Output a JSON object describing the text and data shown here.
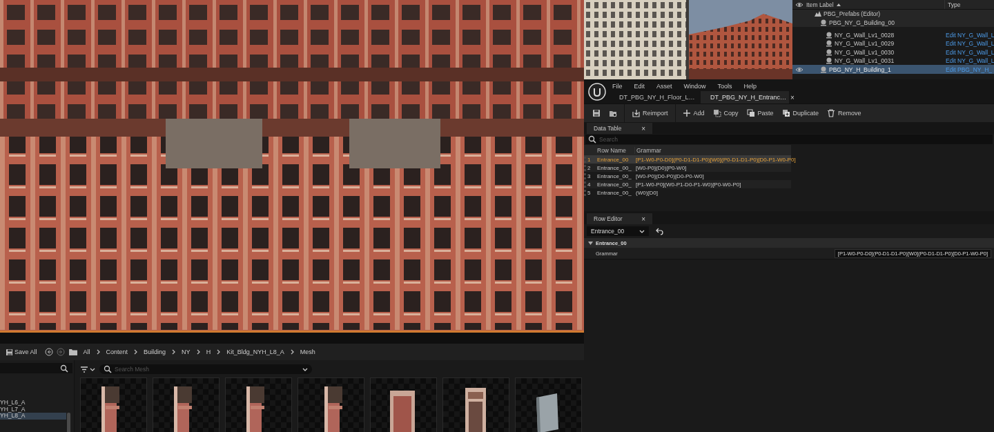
{
  "outliner": {
    "columns": [
      "Item Label",
      "Type"
    ],
    "rows": [
      {
        "label": "PBG_Prefabs (Editor)",
        "kind": "level",
        "selected": false,
        "visible": false,
        "children": [
          {
            "label": "PBG_NY_G_Building_00",
            "kind": "actor",
            "selected": false,
            "visible": false,
            "children": [
              {
                "label": "NY_G_Wall_Lv1_0028",
                "type": "Edit NY_G_Wall_L",
                "kind": "actor",
                "selected": false,
                "visible": false
              },
              {
                "label": "NY_G_Wall_Lv1_0029",
                "type": "Edit NY_G_Wall_L",
                "kind": "actor",
                "selected": false,
                "visible": false
              },
              {
                "label": "NY_G_Wall_Lv1_0030",
                "type": "Edit NY_G_Wall_L",
                "kind": "actor",
                "selected": false,
                "visible": false
              },
              {
                "label": "NY_G_Wall_Lv1_0031",
                "type": "Edit NY_G_Wall_L",
                "kind": "actor",
                "selected": false,
                "visible": false
              }
            ]
          },
          {
            "label": "PBG_NY_H_Building_1",
            "type": "Edit PBG_NY_H_",
            "kind": "actor",
            "selected": true,
            "visible": true
          }
        ]
      }
    ]
  },
  "editor": {
    "menu": [
      "File",
      "Edit",
      "Asset",
      "Window",
      "Tools",
      "Help"
    ],
    "tabs": [
      {
        "label": "DT_PBG_NY_H_Floor_L…",
        "selected": false
      },
      {
        "label": "DT_PBG_NY_H_Entranc…",
        "selected": true,
        "close": "×"
      }
    ],
    "toolbar": [
      "Reimport",
      "Add",
      "Copy",
      "Paste",
      "Duplicate",
      "Remove"
    ]
  },
  "data_table": {
    "tab": "Data Table",
    "close": "×",
    "search_placeholder": "Search",
    "columns": [
      "Row Name",
      "Grammar"
    ],
    "rows": [
      {
        "number": "1",
        "name": "Entrance_00",
        "grammar": "[P1-W0-P0-D0](P0-D1-D1-P0)[W0](P0-D1-D1-P0)[D0-P1-W0-P0]",
        "selected": true
      },
      {
        "number": "2",
        "name": "Entrance_00_",
        "grammar": "[W0-P0](D0)[P0-W0]",
        "selected": false
      },
      {
        "number": "3",
        "name": "Entrance_00_",
        "grammar": "[W0-P0](D0-P0)[D0-P0-W0]",
        "selected": false
      },
      {
        "number": "4",
        "name": "Entrance_00_",
        "grammar": "[P1-W0-P0](W0-P1-D0-P1-W0)[P0-W0-P0]",
        "selected": false
      },
      {
        "number": "5",
        "name": "Entrance_00_",
        "grammar": "(W0)[D0]",
        "selected": false
      }
    ]
  },
  "row_editor": {
    "tab": "Row Editor",
    "close": "×",
    "row_name": "Entrance_00",
    "category": "Entrance_00",
    "properties": [
      {
        "label": "Grammar",
        "value": "[P1-W0-P0-D0](P0-D1-D1-P0)[W0](P0-D1-D1-P0)[D0-P1-W0-P0]"
      }
    ]
  },
  "content_browser": {
    "save_all": "Save All",
    "breadcrumbs": [
      "All",
      "Content",
      "Building",
      "NY",
      "H",
      "Kit_Bldg_NYH_L8_A",
      "Mesh"
    ],
    "folders": [
      {
        "label": "YH_L6_A",
        "selected": false
      },
      {
        "label": "YH_L7_A",
        "selected": false
      },
      {
        "label": "YH_L8_A",
        "selected": true
      }
    ],
    "search_placeholder": "Search Mesh"
  }
}
